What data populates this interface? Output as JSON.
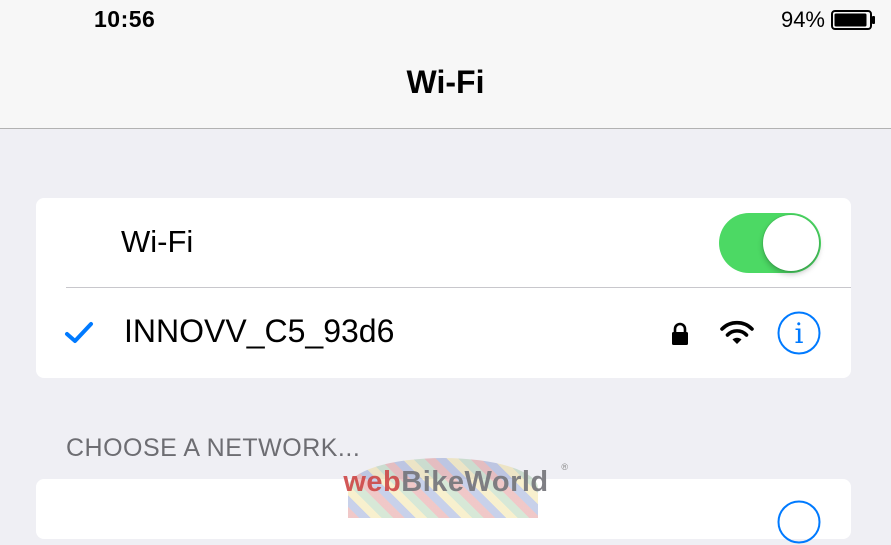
{
  "status_bar": {
    "time": "10:56",
    "battery_percent": "94%",
    "battery_level": 0.94
  },
  "nav": {
    "title": "Wi-Fi"
  },
  "wifi_section": {
    "toggle_label": "Wi-Fi",
    "toggle_on": true,
    "toggle_color": "#4cd964",
    "connected_network": {
      "name": "INNOVV_C5_93d6",
      "secured": true,
      "signal_bars": 3
    }
  },
  "choose_network": {
    "header": "CHOOSE A NETWORK..."
  },
  "icons": {
    "checkmark": "checkmark-icon",
    "lock": "lock-icon",
    "wifi_signal": "wifi-signal-icon",
    "info": "info-icon",
    "battery": "battery-icon"
  },
  "watermark": {
    "text_web": "web",
    "text_bikeworld": "BikeWorld",
    "registered": "®"
  },
  "colors": {
    "accent_blue": "#007aff",
    "background": "#efeff4",
    "switch_on": "#4cd964",
    "section_header": "#6d6d72"
  }
}
